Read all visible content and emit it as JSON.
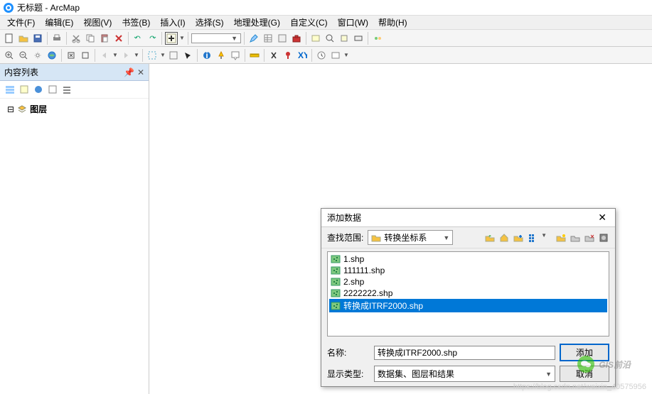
{
  "window": {
    "title": "无标题 - ArcMap"
  },
  "menu": {
    "file": "文件(F)",
    "edit": "编辑(E)",
    "view": "视图(V)",
    "bookmark": "书签(B)",
    "insert": "插入(I)",
    "select": "选择(S)",
    "geoproc": "地理处理(G)",
    "custom": "自定义(C)",
    "window": "窗口(W)",
    "help": "帮助(H)"
  },
  "toc": {
    "title": "内容列表",
    "layers": "图层"
  },
  "dialog": {
    "title": "添加数据",
    "look_in_label": "查找范围:",
    "look_in_value": "转换坐标系",
    "files": [
      "1.shp",
      "111111.shp",
      "2.shp",
      "2222222.shp",
      "转换成ITRF2000.shp"
    ],
    "selected_index": 4,
    "name_label": "名称:",
    "name_value": "转换成ITRF2000.shp",
    "type_label": "显示类型:",
    "type_value": "数据集、图层和结果",
    "add_btn": "添加",
    "cancel_btn": "取消"
  },
  "badge": {
    "text": "GIS前沿"
  },
  "watermark": {
    "text": "https://blog.csdn.net/weixin_40575956"
  }
}
